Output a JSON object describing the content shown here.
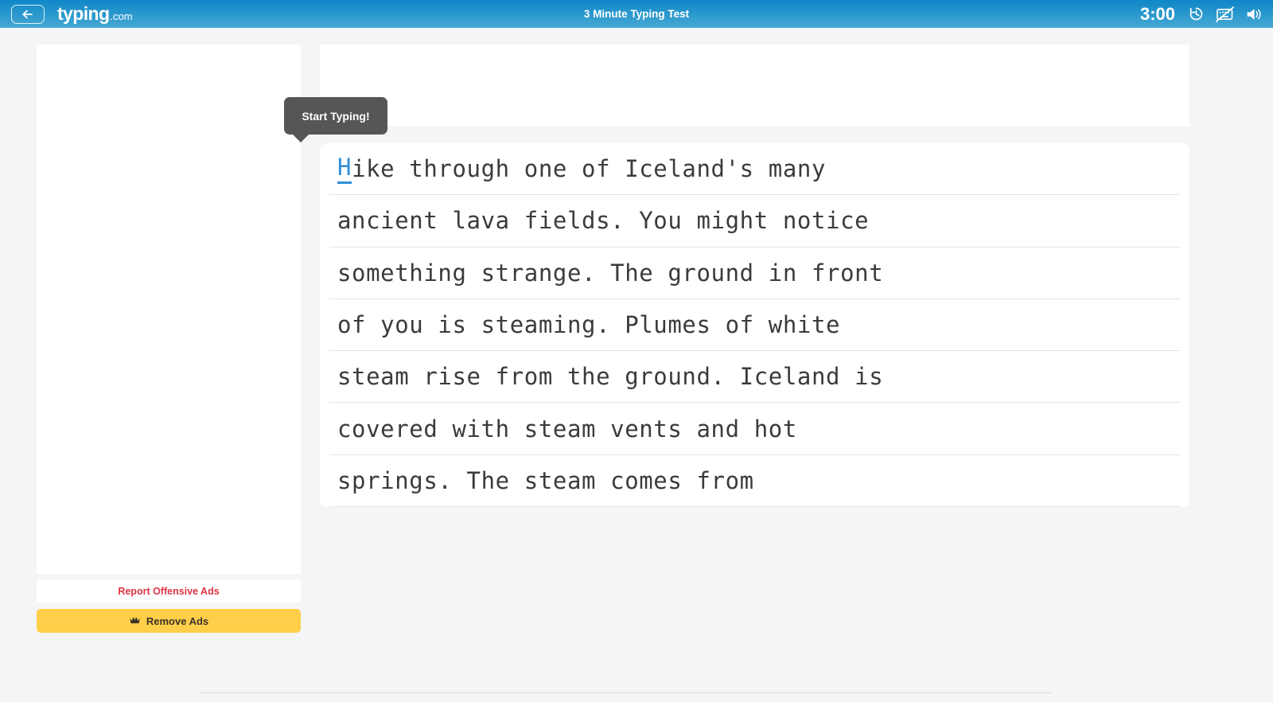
{
  "header": {
    "back_button_label": "Back",
    "back_icon": "arrow-left-icon",
    "brand_main": "typing",
    "brand_tld": ".com",
    "title": "3 Minute Typing Test",
    "timer": "3:00",
    "icons": [
      {
        "name": "history-restart-icon",
        "label": "Restart"
      },
      {
        "name": "keyboard-off-icon",
        "label": "Hide Keyboard"
      },
      {
        "name": "speaker-on-icon",
        "label": "Sound"
      }
    ],
    "gradient_top": "#0f86c8",
    "gradient_bottom": "#48a8d4"
  },
  "sidebar": {
    "ad_placeholder": "",
    "report_ads_label": "Report Offensive Ads",
    "report_ads_color": "#dd3344",
    "remove_ads_label": "Remove Ads",
    "remove_ads_icon": "crown-icon",
    "remove_ads_bg": "#ffcf4a"
  },
  "tooltip": {
    "text": "Start Typing!",
    "bg": "#565656"
  },
  "typing": {
    "cursor_char": "H",
    "cursor_color": "#2f8fd6",
    "lines": [
      {
        "head": "H",
        "rest": "ike through one of Iceland's many"
      },
      {
        "head": "",
        "rest": "ancient lava fields. You might notice"
      },
      {
        "head": "",
        "rest": "something strange. The ground in front"
      },
      {
        "head": "",
        "rest": "of you is steaming. Plumes of white"
      },
      {
        "head": "",
        "rest": "steam rise from the ground. Iceland is"
      },
      {
        "head": "",
        "rest": "covered with steam vents and hot"
      },
      {
        "head": "",
        "rest": "springs. The steam comes from"
      }
    ],
    "full_text": "Hike through one of Iceland's many ancient lava fields. You might notice something strange. The ground in front of you is steaming. Plumes of white steam rise from the ground. Iceland is covered with steam vents and hot springs. The steam comes from"
  }
}
